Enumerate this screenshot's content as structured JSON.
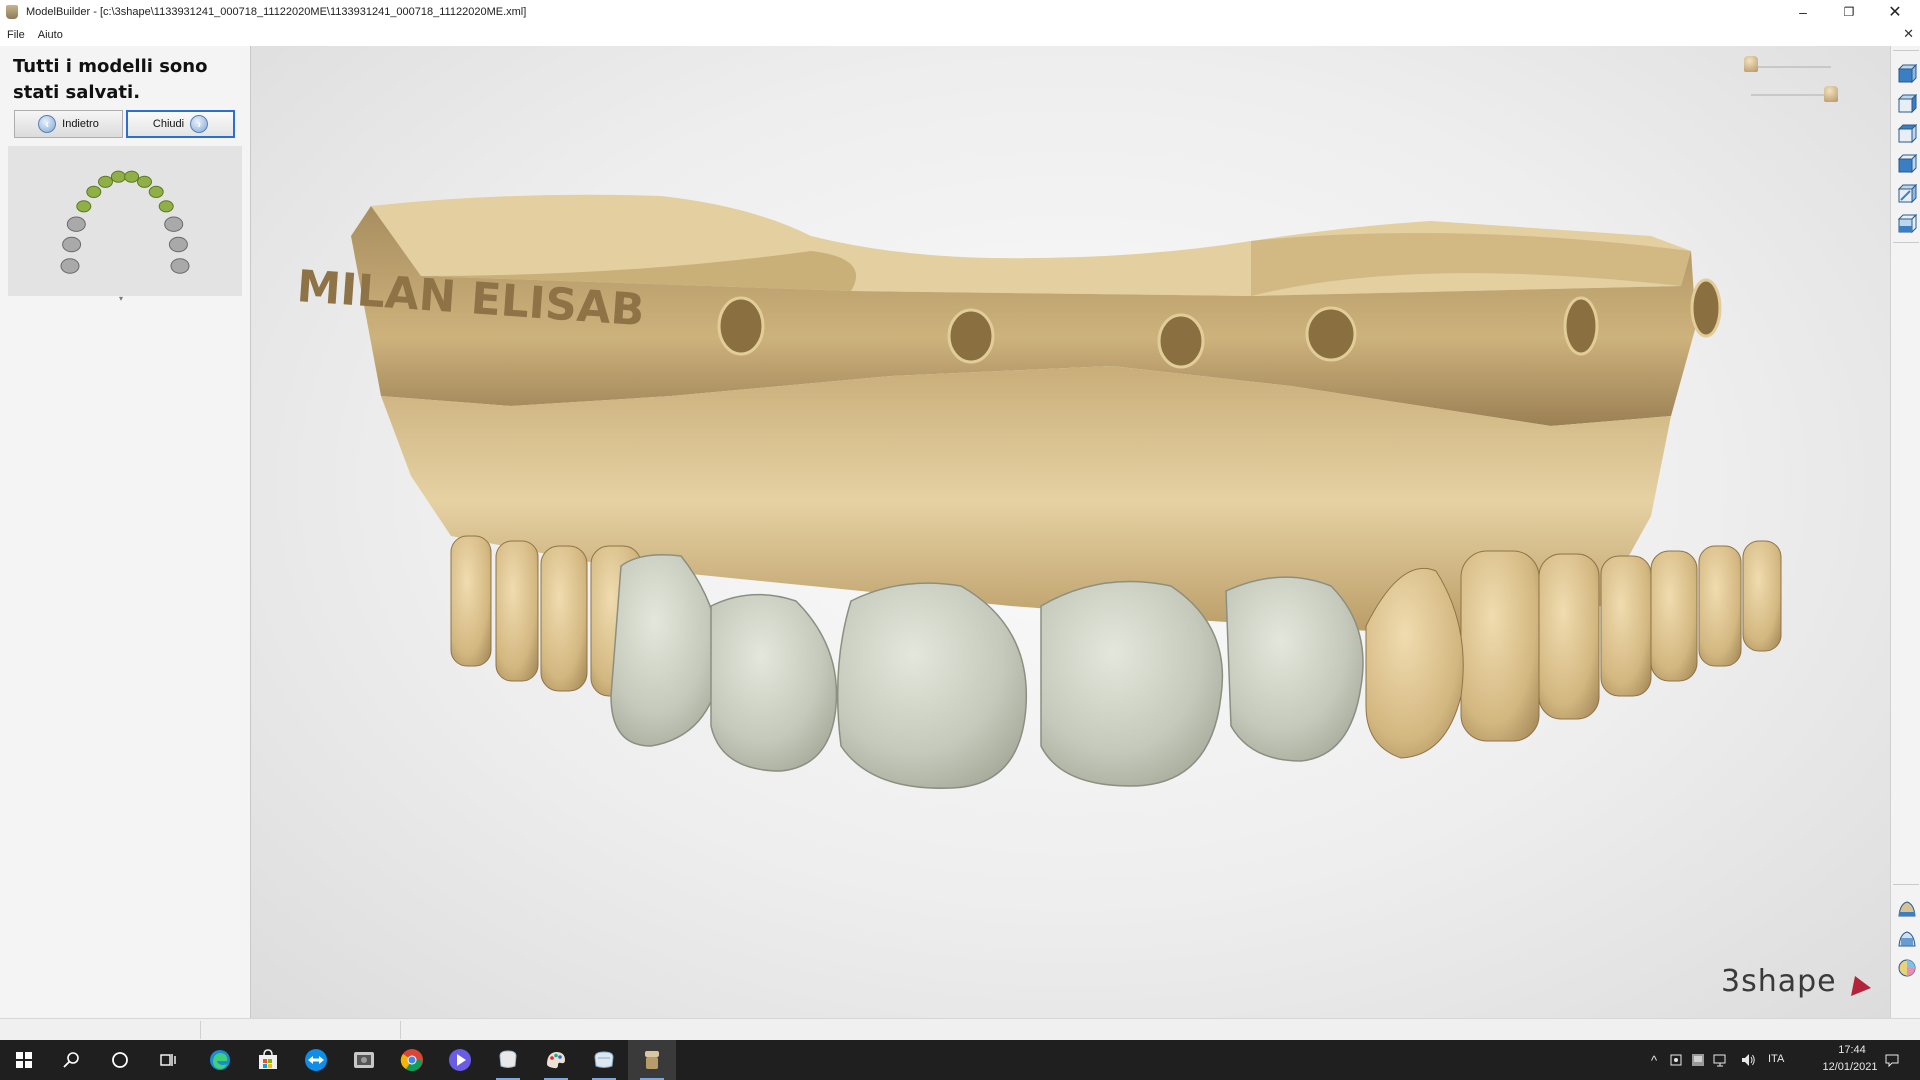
{
  "window": {
    "title": "ModelBuilder - [c:\\3shape\\1133931241_000718_11122020ME\\1133931241_000718_11122020ME.xml]",
    "minimize": "–",
    "maximize": "❐",
    "close": "✕"
  },
  "menu": {
    "items": [
      {
        "label": "File"
      },
      {
        "label": "Aiuto"
      }
    ],
    "close_label": "✕"
  },
  "left_panel": {
    "status_message": "Tutti i modelli sono stati salvati.",
    "back_button": "Indietro",
    "close_button": "Chiudi",
    "arch_overview": {
      "jaw": "upper",
      "tooth_count": 14,
      "selected_teeth": "anterior teeth highlighted green",
      "colors": {
        "selected": "#8fb046",
        "unselected": "#a9a9a9"
      }
    },
    "scroll_indicator": "▾"
  },
  "viewport": {
    "model_engraving": "MILAN ELISAB",
    "brand": "3shape",
    "colors": {
      "gypsum": "#d8c08e",
      "crown": "#c7cbbd",
      "accent": "#b3243a"
    }
  },
  "right_toolbar": {
    "icons": [
      "view-front-icon",
      "view-back-icon",
      "view-left-icon",
      "view-right-icon",
      "view-top-icon",
      "view-bottom-icon",
      "model-visibility-icon",
      "model-transparency-icon",
      "color-mode-icon"
    ]
  },
  "taskbar": {
    "apps": [
      "start-icon",
      "search-icon",
      "cortana-icon",
      "task-view-icon",
      "edge-icon",
      "store-icon",
      "teamviewer-icon",
      "photos-icon",
      "chrome-icon",
      "media-player-icon",
      "dental-app-icon",
      "paint-icon",
      "scanner-app-icon",
      "modelbuilder-icon"
    ],
    "language": "ITA",
    "time": "17:44",
    "date": "12/01/2021"
  }
}
